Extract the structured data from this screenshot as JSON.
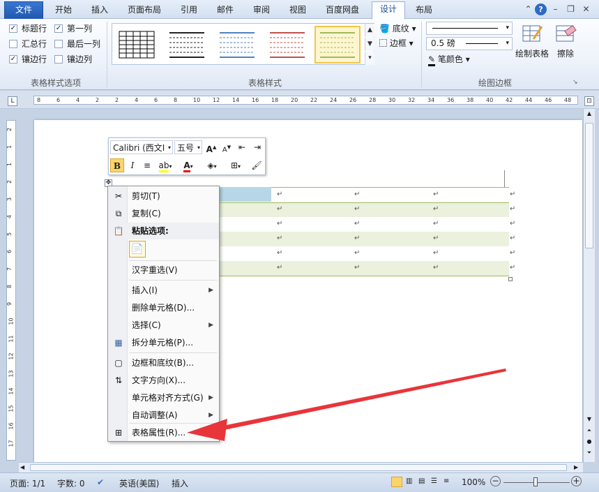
{
  "tabs": [
    "文件",
    "开始",
    "插入",
    "页面布局",
    "引用",
    "邮件",
    "审阅",
    "视图",
    "百度网盘",
    "设计",
    "布局"
  ],
  "active_tab": "设计",
  "ribbon": {
    "style_options": {
      "label": "表格样式选项",
      "items": [
        {
          "label": "标题行",
          "checked": true
        },
        {
          "label": "第一列",
          "checked": true
        },
        {
          "label": "汇总行",
          "checked": false
        },
        {
          "label": "最后一列",
          "checked": false
        },
        {
          "label": "镶边行",
          "checked": true
        },
        {
          "label": "镶边列",
          "checked": false
        }
      ]
    },
    "table_styles": {
      "label": "表格样式",
      "shading": "底纹",
      "borders": "边框"
    },
    "draw_borders": {
      "label": "绘图边框",
      "weight": "0.5 磅",
      "pen_color": "笔颜色",
      "draw_table": "绘制表格",
      "eraser": "擦除"
    }
  },
  "mini_toolbar": {
    "font": "Calibri (西文I",
    "size": "五号"
  },
  "context_menu": [
    {
      "label": "剪切(T)",
      "icon": "scissors-icon"
    },
    {
      "label": "复制(C)",
      "icon": "copy-icon"
    },
    {
      "label": "粘贴选项:",
      "icon": "paste-icon",
      "bold": true
    },
    {
      "label": "汉字重选(V)"
    },
    {
      "label": "插入(I)",
      "submenu": true
    },
    {
      "label": "删除单元格(D)..."
    },
    {
      "label": "选择(C)",
      "submenu": true
    },
    {
      "label": "拆分单元格(P)...",
      "icon": "split-cells-icon"
    },
    {
      "label": "边框和底纹(B)...",
      "icon": "borders-icon"
    },
    {
      "label": "文字方向(X)...",
      "icon": "text-direction-icon"
    },
    {
      "label": "单元格对齐方式(G)",
      "submenu": true
    },
    {
      "label": "自动调整(A)",
      "submenu": true
    },
    {
      "label": "表格属性(R)...",
      "icon": "table-properties-icon"
    }
  ],
  "ruler_numbers": [
    "8",
    "6",
    "4",
    "2",
    "2",
    "4",
    "6",
    "8",
    "10",
    "12",
    "14",
    "16",
    "18",
    "20",
    "22",
    "24",
    "26",
    "28",
    "30",
    "32",
    "34",
    "36",
    "38",
    "40",
    "42",
    "44",
    "46",
    "48"
  ],
  "status": {
    "page": "页面: 1/1",
    "words": "字数: 0",
    "language": "英语(美国)",
    "mode": "插入",
    "zoom": "100%"
  },
  "colors": {
    "accent": "#1e57b0",
    "arrow": "#e8353a",
    "table_band": "#eaf1dd",
    "selected_cell": "#b7d7e8"
  }
}
